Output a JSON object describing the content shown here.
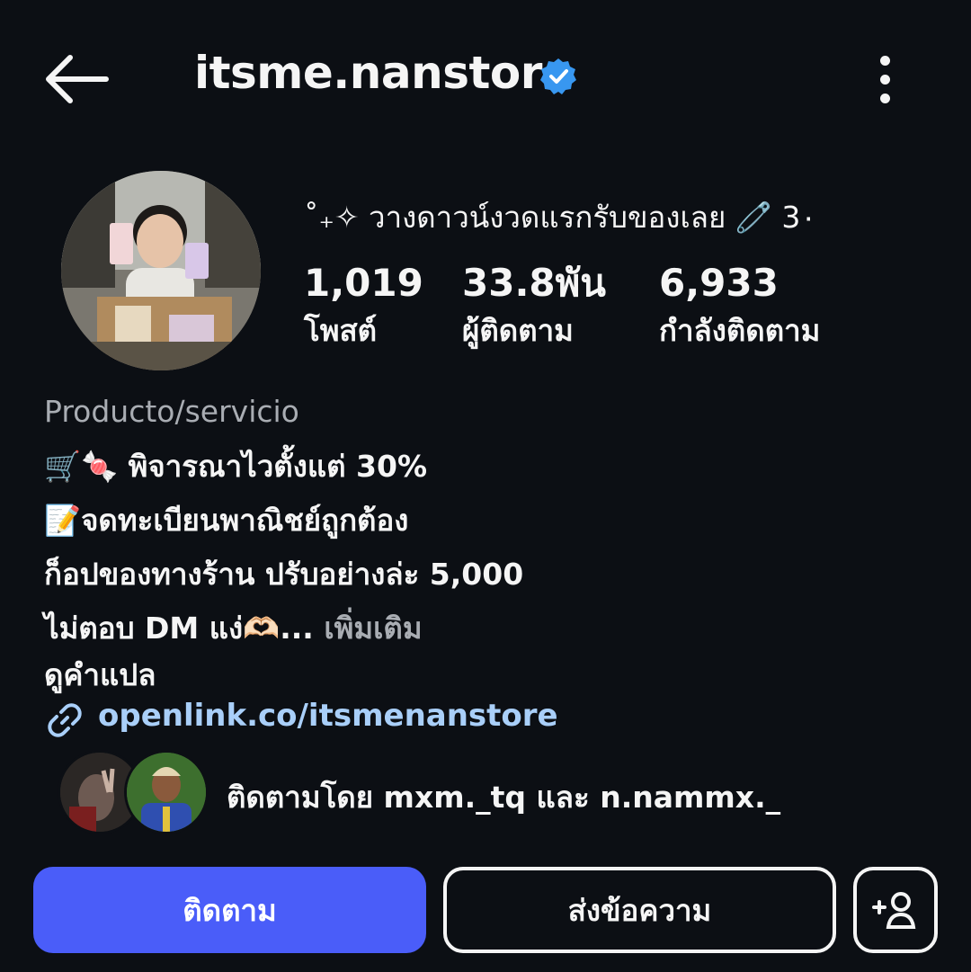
{
  "header": {
    "username": "itsme.nanstore",
    "back_icon": "arrow-left-icon",
    "verified_icon": "verified-badge-icon",
    "more_icon": "more-vertical-icon",
    "accent": "#3897f0"
  },
  "profile": {
    "display_name": "˚₊✧ วางดาวน์งวดแรกรับของเลย 🧷 3٠",
    "stats": [
      {
        "value": "1,019",
        "label": "โพสต์"
      },
      {
        "value": "33.8พัน",
        "label": "ผู้ติดตาม"
      },
      {
        "value": "6,933",
        "label": "กำลังติดตาม"
      }
    ],
    "category": "Producto/servicio",
    "bio_lines": [
      "🛒🍬 พิจารณาไวตั้งแต่ 30%",
      "📝จดทะเบียนพาณิชย์ถูกต้อง",
      "ก็อปของทางร้าน ปรับอย่างล่ะ 5,000",
      " ไม่ตอบ DM แง่🫶🏻..."
    ],
    "more_label": " เพิ่มเติม",
    "translate_label": "ดูคำแปล",
    "link": "openlink.co/itsmenanstore",
    "link_color": "#a9cff9",
    "followed_by": "ติดตามโดย mxm._tq และ n.nammx._"
  },
  "actions": {
    "follow_label": "ติดตาม",
    "message_label": "ส่งข้อความ",
    "suggest_icon": "add-person-icon",
    "follow_color": "#4a5df9"
  }
}
